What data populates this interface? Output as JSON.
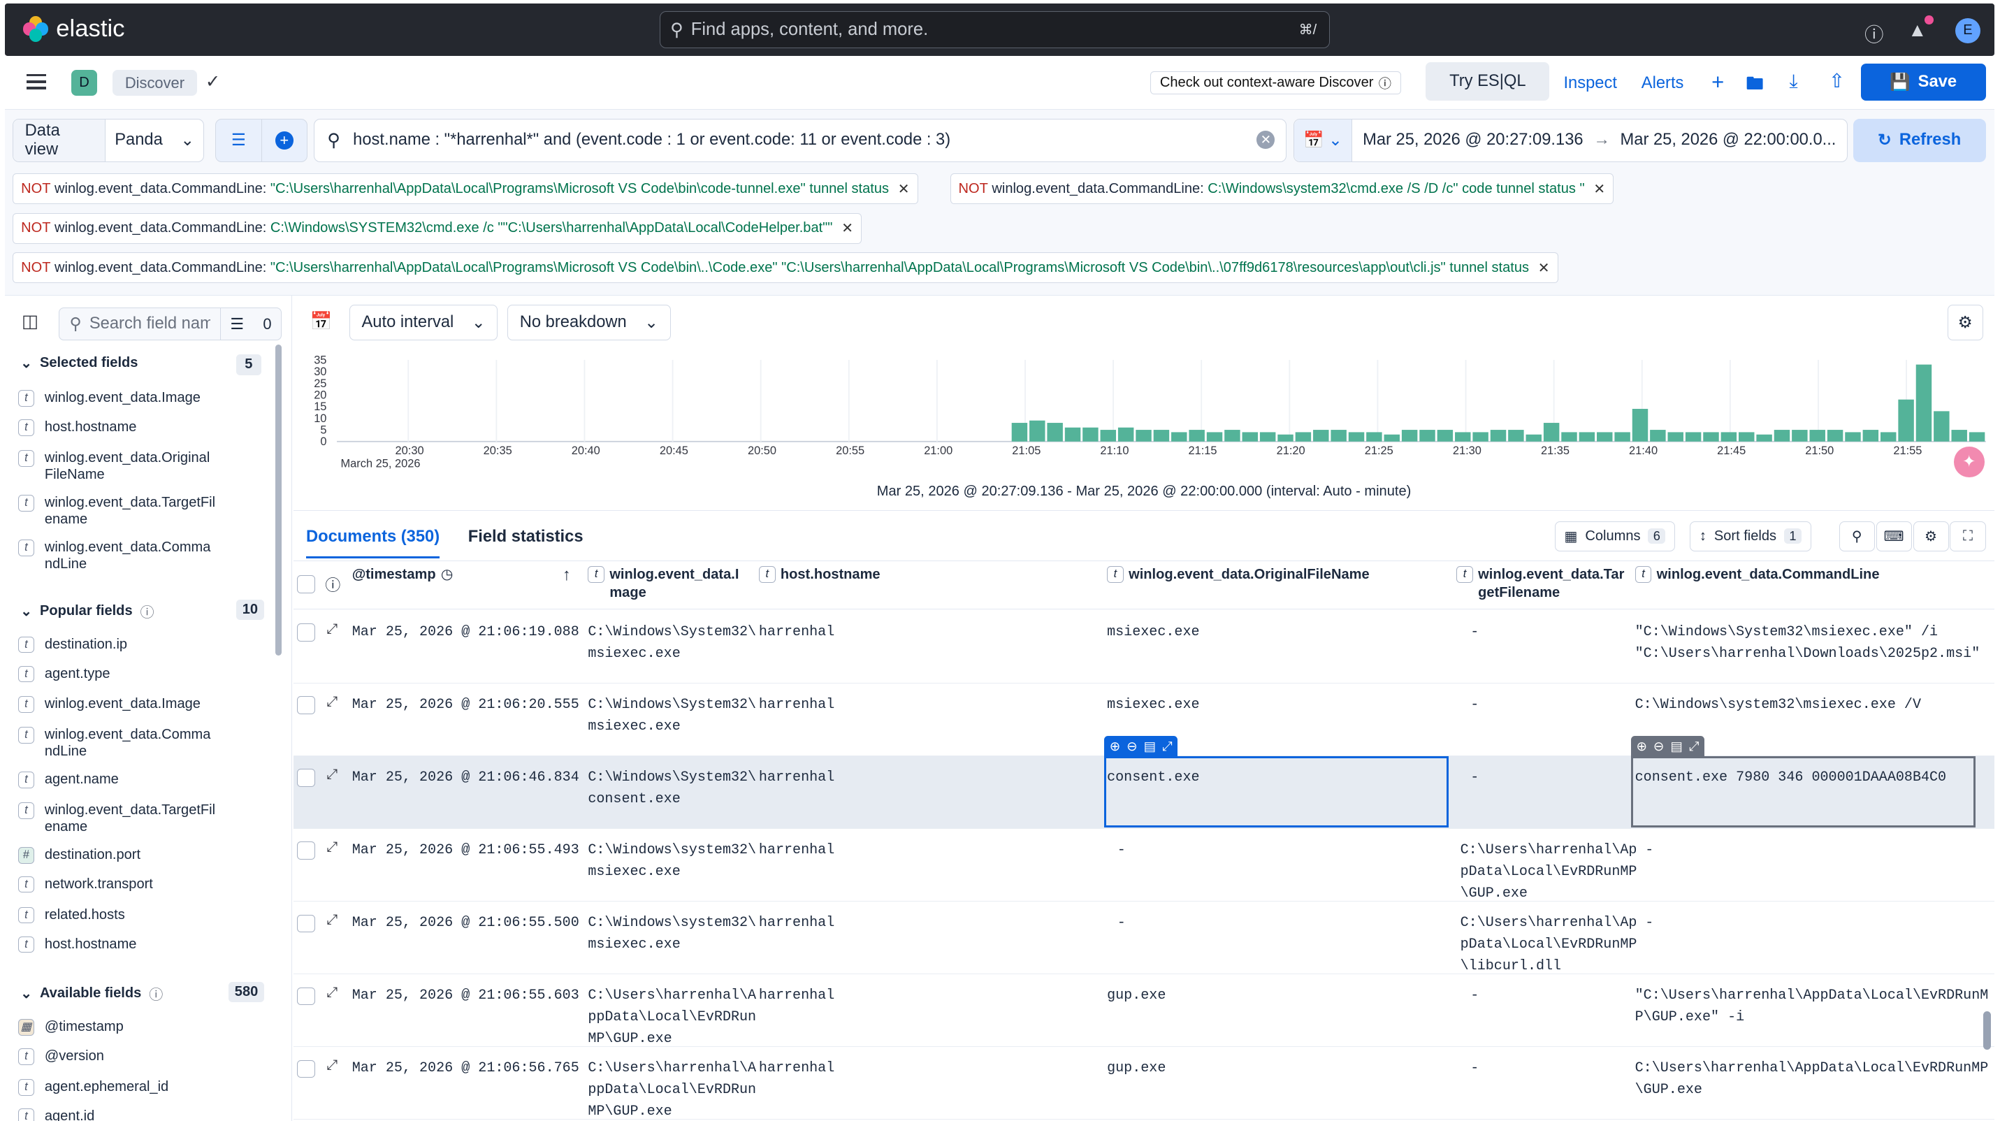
{
  "app": {
    "brand": "elastic",
    "search_placeholder": "Find apps, content, and more.",
    "search_shortcut": "⌘/",
    "avatar": "E"
  },
  "nav": {
    "space_badge": "D",
    "breadcrumb": "Discover",
    "context_button": "Check out context-aware Discover",
    "try_esql": "Try ES|QL",
    "inspect": "Inspect",
    "alerts": "Alerts",
    "save": "Save"
  },
  "query": {
    "data_view_label": "Data view",
    "data_view_value": "Panda",
    "text": "host.name : \"*harrenhal*\" and (event.code : 1 or event.code: 11 or event.code : 3)",
    "date_start": "Mar 25, 2026 @ 20:27:09.136",
    "date_end": "Mar 25, 2026 @ 22:00:00.0...",
    "refresh": "Refresh"
  },
  "filters": [
    {
      "not": "NOT",
      "field": "winlog.event_data.CommandLine:",
      "value": "\"C:\\Users\\harrenhal\\AppData\\Local\\Programs\\Microsoft VS Code\\bin\\code-tunnel.exe\" tunnel status"
    },
    {
      "not": "NOT",
      "field": "winlog.event_data.CommandLine:",
      "value": "C:\\Windows\\system32\\cmd.exe /S /D /c\" code tunnel status \""
    },
    {
      "not": "NOT",
      "field": "winlog.event_data.CommandLine:",
      "value": "C:\\Windows\\SYSTEM32\\cmd.exe /c \"\"C:\\Users\\harrenhal\\AppData\\Local\\CodeHelper.bat\"\""
    },
    {
      "not": "NOT",
      "field": "winlog.event_data.CommandLine:",
      "value": "\"C:\\Users\\harrenhal\\AppData\\Local\\Programs\\Microsoft VS Code\\bin\\..\\Code.exe\" \"C:\\Users\\harrenhal\\AppData\\Local\\Programs\\Microsoft VS Code\\bin\\..\\07ff9d6178\\resources\\app\\out\\cli.js\" tunnel status"
    }
  ],
  "sidebar": {
    "search_placeholder": "Search field names",
    "filter_count": "0",
    "selected": {
      "title": "Selected fields",
      "count": "5",
      "items": [
        {
          "type": "t",
          "name": "winlog.event_data.Image"
        },
        {
          "type": "t",
          "name": "host.hostname"
        },
        {
          "type": "t",
          "name": "winlog.event_data.Original\nFileName"
        },
        {
          "type": "t",
          "name": "winlog.event_data.TargetFil\nename"
        },
        {
          "type": "t",
          "name": "winlog.event_data.Comma\nndLine"
        }
      ]
    },
    "popular": {
      "title": "Popular fields",
      "count": "10",
      "items": [
        {
          "type": "t",
          "name": "destination.ip"
        },
        {
          "type": "t",
          "name": "agent.type"
        },
        {
          "type": "t",
          "name": "winlog.event_data.Image"
        },
        {
          "type": "t",
          "name": "winlog.event_data.Comma\nndLine"
        },
        {
          "type": "t",
          "name": "agent.name"
        },
        {
          "type": "t",
          "name": "winlog.event_data.TargetFil\nename"
        },
        {
          "type": "#",
          "name": "destination.port"
        },
        {
          "type": "t",
          "name": "network.transport"
        },
        {
          "type": "t",
          "name": "related.hosts"
        },
        {
          "type": "t",
          "name": "host.hostname"
        }
      ]
    },
    "available": {
      "title": "Available fields",
      "count": "580",
      "items": [
        {
          "type": "cal",
          "name": "@timestamp"
        },
        {
          "type": "t",
          "name": "@version"
        },
        {
          "type": "t",
          "name": "agent.ephemeral_id"
        },
        {
          "type": "t",
          "name": "agent.id"
        }
      ]
    }
  },
  "histogram": {
    "interval_control": "Auto interval",
    "breakdown_control": "No breakdown",
    "caption": "Mar 25, 2026 @ 20:27:09.136 - Mar 25, 2026 @ 22:00:00.000 (interval: Auto - minute)",
    "bar_color": "#54b399"
  },
  "chart_data": {
    "type": "bar",
    "y_ticks": [
      "35",
      "30",
      "25",
      "20",
      "15",
      "10",
      "5",
      "0"
    ],
    "x_ticks": [
      "20:30",
      "20:35",
      "20:40",
      "20:45",
      "20:50",
      "20:55",
      "21:00",
      "21:05",
      "21:10",
      "21:15",
      "21:20",
      "21:25",
      "21:30",
      "21:35",
      "21:40",
      "21:45",
      "21:50",
      "21:55"
    ],
    "x_sublabel": "March 25, 2026",
    "ylim": [
      0,
      35
    ],
    "values": [
      0,
      0,
      0,
      0,
      0,
      0,
      0,
      0,
      0,
      0,
      0,
      0,
      0,
      0,
      0,
      0,
      0,
      0,
      0,
      0,
      0,
      0,
      0,
      0,
      0,
      0,
      0,
      0,
      0,
      0,
      0,
      0,
      0,
      0,
      0,
      0,
      0,
      0,
      8,
      9,
      8,
      6,
      6,
      5,
      6,
      5,
      5,
      4,
      5,
      4,
      5,
      4,
      4,
      3,
      4,
      5,
      5,
      4,
      4,
      3,
      5,
      5,
      5,
      4,
      4,
      5,
      5,
      3,
      8,
      4,
      4,
      4,
      4,
      14,
      5,
      4,
      4,
      4,
      4,
      4,
      3,
      5,
      5,
      5,
      5,
      4,
      5,
      4,
      18,
      33,
      13,
      5,
      4
    ]
  },
  "tabs": {
    "documents": "Documents (350)",
    "field_stats": "Field statistics",
    "columns": "Columns",
    "columns_count": "6",
    "sort": "Sort fields",
    "sort_count": "1"
  },
  "table": {
    "headers": [
      "@timestamp",
      "winlog.event_data.I\nmage",
      "host.hostname",
      "winlog.event_data.OriginalFileName",
      "winlog.event_data.Tar\ngetFilename",
      "winlog.event_data.CommandLine"
    ],
    "rows": [
      [
        "Mar 25, 2026 @ 21:06:19.088",
        "C:\\Windows\\System32\\\nmsiexec.exe",
        "harrenhal",
        "msiexec.exe",
        "-",
        "\"C:\\Windows\\System32\\msiexec.exe\" /i\n\"C:\\Users\\harrenhal\\Downloads\\2025p2.msi\""
      ],
      [
        "Mar 25, 2026 @ 21:06:20.555",
        "C:\\Windows\\System32\\\nmsiexec.exe",
        "harrenhal",
        "msiexec.exe",
        "-",
        "C:\\Windows\\system32\\msiexec.exe /V"
      ],
      [
        "Mar 25, 2026 @ 21:06:46.834",
        "C:\\Windows\\System32\\\nconsent.exe",
        "harrenhal",
        "consent.exe",
        "-",
        "consent.exe 7980 346 000001DAAA08B4C0"
      ],
      [
        "Mar 25, 2026 @ 21:06:55.493",
        "C:\\Windows\\system32\\\nmsiexec.exe",
        "harrenhal",
        "-",
        "C:\\Users\\harrenhal\\Ap\npData\\Local\\EvRDRunMP\n\\GUP.exe",
        "-"
      ],
      [
        "Mar 25, 2026 @ 21:06:55.500",
        "C:\\Windows\\system32\\\nmsiexec.exe",
        "harrenhal",
        "-",
        "C:\\Users\\harrenhal\\Ap\npData\\Local\\EvRDRunMP\n\\libcurl.dll",
        "-"
      ],
      [
        "Mar 25, 2026 @ 21:06:55.603",
        "C:\\Users\\harrenhal\\A\nppData\\Local\\EvRDRun\nMP\\GUP.exe",
        "harrenhal",
        "gup.exe",
        "-",
        "\"C:\\Users\\harrenhal\\AppData\\Local\\EvRDRunM\nP\\GUP.exe\" -i"
      ],
      [
        "Mar 25, 2026 @ 21:06:56.765",
        "C:\\Users\\harrenhal\\A\nppData\\Local\\EvRDRun\nMP\\GUP.exe",
        "harrenhal",
        "gup.exe",
        "-",
        "C:\\Users\\harrenhal\\AppData\\Local\\EvRDRunMP\n\\GUP.exe"
      ]
    ]
  }
}
